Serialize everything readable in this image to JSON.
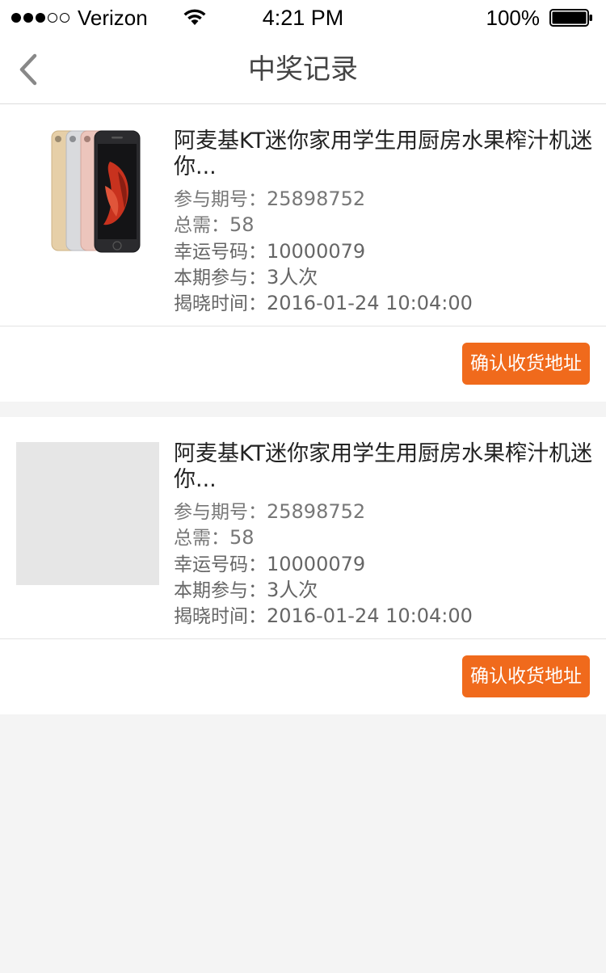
{
  "status_bar": {
    "carrier": "Verizon",
    "time": "4:21 PM",
    "battery": "100%",
    "signal_bars_filled": 3,
    "signal_bars_total": 5
  },
  "nav": {
    "title": "中奖记录",
    "back_icon": "chevron-left-icon"
  },
  "colors": {
    "accent": "#f06a1c",
    "lucky_number": "#f06522",
    "background": "#f4f4f4"
  },
  "records": [
    {
      "title": "阿麦基KT迷你家用学生用厨房水果榨汁机迷你...",
      "image": "iphone-product-image",
      "period_label": "参与期号：",
      "period": "25898752",
      "total_label": "总需：",
      "total": "58",
      "lucky_label": "幸运号码：",
      "lucky_number": "10000079",
      "participation_label": "本期参与：",
      "participation": "3人次",
      "reveal_label": "揭晓时间：",
      "reveal_time": "2016-01-24 10:04:00",
      "button": "确认收货地址"
    },
    {
      "title": "阿麦基KT迷你家用学生用厨房水果榨汁机迷你...",
      "image": "image-placeholder",
      "period_label": "参与期号：",
      "period": "25898752",
      "total_label": "总需：",
      "total": "58",
      "lucky_label": "幸运号码：",
      "lucky_number": "10000079",
      "participation_label": "本期参与：",
      "participation": "3人次",
      "reveal_label": "揭晓时间：",
      "reveal_time": "2016-01-24 10:04:00",
      "button": "确认收货地址"
    }
  ]
}
